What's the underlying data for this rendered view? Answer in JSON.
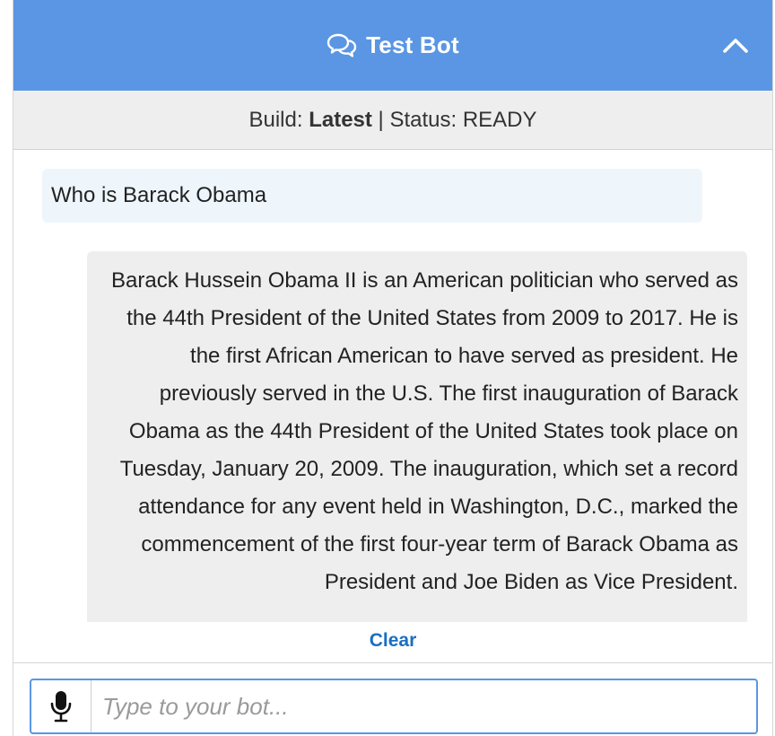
{
  "header": {
    "title": "Test Bot",
    "icon": "chat-bubbles-icon",
    "collapse_icon": "chevron-up-icon",
    "color": "#5a96e3"
  },
  "status_bar": {
    "build_label": "Build: ",
    "build_value": "Latest",
    "separator": " | ",
    "status_text": "Status: READY"
  },
  "conversation": {
    "user_message": "Who is Barack Obama",
    "bot_message": "Barack Hussein Obama II is an American politician who served as the 44th President of the United States from 2009 to 2017. He is the first African American to have served as president. He previously served in the U.S. The first inauguration of Barack Obama as the 44th President of the United States took place on Tuesday, January 20, 2009. The inauguration, which set a record attendance for any event held in Washington, D.C., marked the commencement of the first four-year term of Barack Obama as President and Joe Biden as Vice President."
  },
  "clear_label": "Clear",
  "input": {
    "placeholder": "Type to your bot...",
    "value": "",
    "mic_icon": "microphone-icon"
  }
}
